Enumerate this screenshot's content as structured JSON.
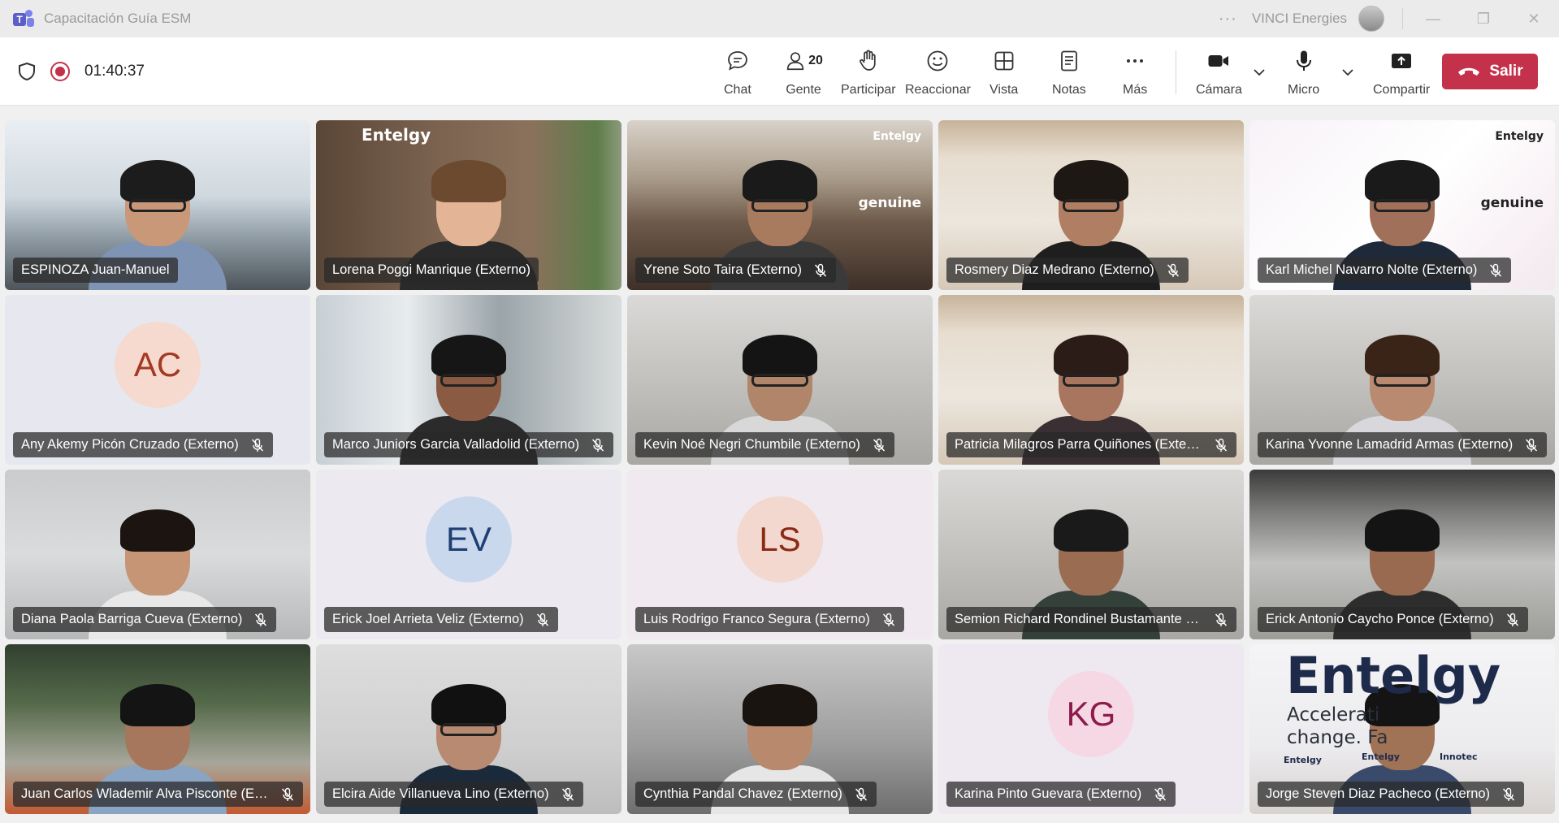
{
  "window": {
    "title": "Capacitación Guía ESM",
    "org": "VINCI Energies",
    "more": "···",
    "minimize": "—",
    "restore": "❐",
    "close": "✕"
  },
  "meeting": {
    "timer": "01:40:37",
    "recording_color": "#c4314b"
  },
  "toolbar": {
    "chat": "Chat",
    "people": "Gente",
    "people_count": "20",
    "raise": "Participar",
    "react": "Reaccionar",
    "view": "Vista",
    "notes": "Notas",
    "more": "Más",
    "camera": "Cámara",
    "mic": "Micro",
    "share": "Compartir",
    "leave": "Salir",
    "leave_color": "#c4314b"
  },
  "participants": [
    {
      "name": "ESPINOZA Juan-Manuel",
      "muted": false,
      "video": true,
      "bg": "office",
      "skin": "#c89878",
      "hair": "#1c1c1c",
      "shirt": "#7f93b5",
      "glasses": true
    },
    {
      "name": "Lorena Poggi Manrique (Externo)",
      "muted": false,
      "video": true,
      "bg": "wood",
      "skin": "#e3b596",
      "hair": "#6b4a30",
      "shirt": "#2a2a2a",
      "glasses": false,
      "logo": "Entelgy"
    },
    {
      "name": "Yrene Soto Taira (Externo)",
      "muted": true,
      "video": true,
      "bg": "library",
      "skin": "#a87a5e",
      "hair": "#1a1a1a",
      "shirt": "#3a3a3a",
      "glasses": true,
      "logo": "Entelgy",
      "logo2": "genuine"
    },
    {
      "name": "Rosmery Diaz Medrano (Externo)",
      "muted": true,
      "video": true,
      "bg": "room",
      "skin": "#b07e62",
      "hair": "#1e1814",
      "shirt": "#1e1e1e",
      "glasses": true
    },
    {
      "name": "Karl Michel Navarro Nolte (Externo)",
      "muted": true,
      "video": true,
      "bg": "wave",
      "skin": "#a0705a",
      "hair": "#1a1a1a",
      "shirt": "#1e2a3a",
      "glasses": true,
      "logo": "Entelgy",
      "logo2": "genuine"
    },
    {
      "name": "Any Akemy Picón Cruzado (Externo)",
      "muted": true,
      "video": false,
      "initials": "AC",
      "avatar_bg": "#f6d9cf",
      "avatar_fg": "#a33a22",
      "tile_bg": "#e7e8ef"
    },
    {
      "name": "Marco Juniors Garcia Valladolid (Externo)",
      "muted": true,
      "video": true,
      "bg": "window",
      "skin": "#8a5a42",
      "hair": "#161616",
      "shirt": "#2b2b2b",
      "glasses": true
    },
    {
      "name": "Kevin Noé Negri Chumbile (Externo)",
      "muted": true,
      "video": true,
      "bg": "blur",
      "skin": "#b0856a",
      "hair": "#141414",
      "shirt": "#d8d8d8",
      "glasses": true
    },
    {
      "name": "Patricia Milagros Parra Quiñones (Externo)",
      "muted": true,
      "video": true,
      "bg": "room",
      "skin": "#a8765e",
      "hair": "#2c1c18",
      "shirt": "#3a3034",
      "glasses": true
    },
    {
      "name": "Karina Yvonne Lamadrid Armas (Externo)",
      "muted": true,
      "video": true,
      "bg": "blur",
      "skin": "#b98a70",
      "hair": "#3a2418",
      "shirt": "#d7d7dc",
      "glasses": true
    },
    {
      "name": "Diana Paola Barriga Cueva (Externo)",
      "muted": true,
      "video": true,
      "bg": "blur2",
      "skin": "#c59576",
      "hair": "#1b1410",
      "shirt": "#e8e8e8",
      "glasses": false
    },
    {
      "name": "Erick Joel Arrieta Veliz (Externo)",
      "muted": true,
      "video": false,
      "initials": "EV",
      "avatar_bg": "#cad8ee",
      "avatar_fg": "#1f3f74",
      "tile_bg": "#eceaf0"
    },
    {
      "name": "Luis Rodrigo Franco Segura (Externo)",
      "muted": true,
      "video": false,
      "initials": "LS",
      "avatar_bg": "#f3d8cf",
      "avatar_fg": "#8a2b14",
      "tile_bg": "#f1e9f0"
    },
    {
      "name": "Semion Richard Rondinel Bustamante (Externo)",
      "muted": true,
      "video": true,
      "bg": "blur",
      "skin": "#9a6c52",
      "hair": "#1a1a1a",
      "shirt": "#34403a",
      "glasses": false
    },
    {
      "name": "Erick Antonio Caycho Ponce (Externo)",
      "muted": true,
      "video": true,
      "bg": "ceiling",
      "skin": "#9a6a50",
      "hair": "#141414",
      "shirt": "#2d2d2d",
      "glasses": false
    },
    {
      "name": "Juan Carlos Wlademir Alva Pisconte (Externo)",
      "muted": true,
      "video": true,
      "bg": "garden",
      "skin": "#a6775c",
      "hair": "#141414",
      "shirt": "#8aa4c4",
      "glasses": false
    },
    {
      "name": "Elcira Aide Villanueva Lino (Externo)",
      "muted": true,
      "video": true,
      "bg": "plain",
      "skin": "#b98a72",
      "hair": "#111111",
      "shirt": "#1b2a3a",
      "glasses": true
    },
    {
      "name": "Cynthia Pandal Chavez (Externo)",
      "muted": true,
      "video": true,
      "bg": "plain2",
      "skin": "#b8896c",
      "hair": "#1a1410",
      "shirt": "#e6e6e6",
      "glasses": false
    },
    {
      "name": "Karina Pinto Guevara (Externo)",
      "muted": true,
      "video": false,
      "initials": "KG",
      "avatar_bg": "#f6d8e4",
      "avatar_fg": "#8d1b4c",
      "tile_bg": "#eee8f0"
    },
    {
      "name": "Jorge Steven Diaz Pacheco (Externo)",
      "muted": true,
      "video": true,
      "bg": "sign",
      "skin": "#a07256",
      "hair": "#141414",
      "shirt": "#3a4a6a",
      "glasses": false,
      "logo": "Entelgy",
      "sign_line1": "Accelerati",
      "sign_line2": "change. Fa",
      "sign_small": [
        "Entelgy",
        "Entelgy",
        "Innotec"
      ]
    }
  ]
}
